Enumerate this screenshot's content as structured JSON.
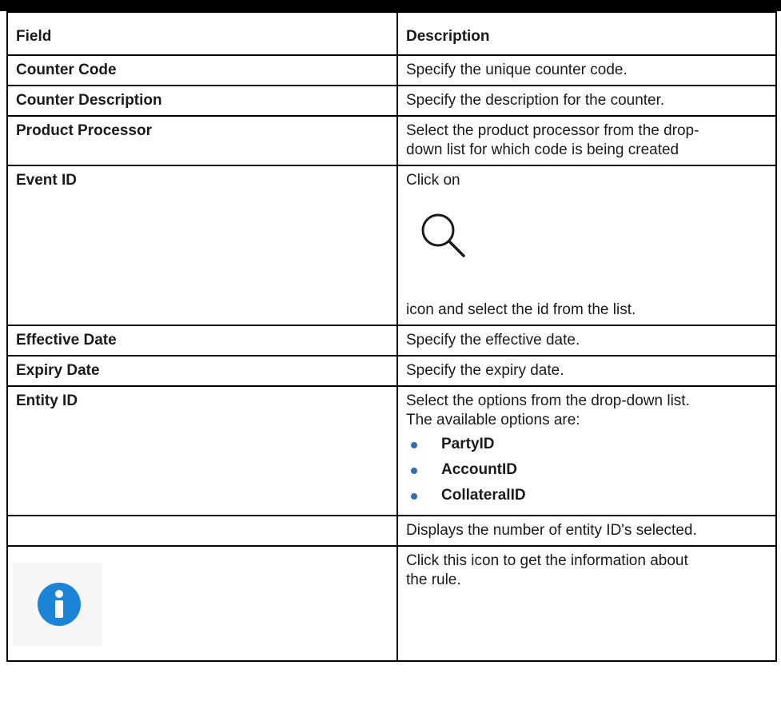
{
  "table": {
    "header": {
      "field": "Field",
      "description": "Description"
    },
    "rows": {
      "counter_code": {
        "field": "Counter Code",
        "description": "Specify the unique counter code."
      },
      "counter_description": {
        "field": "Counter Description",
        "description": "Specify the description for the counter."
      },
      "product_processor": {
        "field": "Product Processor",
        "description_line1": "Select the product processor from the drop-",
        "description_line2": "down list for which code is being created"
      },
      "event_id": {
        "field": "Event ID",
        "description_before": "Click on",
        "icon": "search-icon",
        "description_after": "icon and select the id from the list."
      },
      "effective_date": {
        "field": "Effective Date",
        "description": "Specify the effective date."
      },
      "expiry_date": {
        "field": "Expiry Date",
        "description": "Specify the expiry date."
      },
      "entity_id": {
        "field": "Entity ID",
        "description_line1": "Select the options from the drop-down list.",
        "description_line2": "The available options are:",
        "options": [
          "PartyID",
          "AccountID",
          "CollateralID"
        ]
      },
      "entity_count": {
        "field": "",
        "description": "Displays the number of entity ID's selected."
      },
      "info": {
        "icon": "info-icon",
        "description_line1": "Click this icon to get the information about",
        "description_line2": "the rule."
      }
    }
  },
  "colors": {
    "border": "#000000",
    "bullet": "#2d6db5",
    "info_icon": "#1b84d6"
  }
}
